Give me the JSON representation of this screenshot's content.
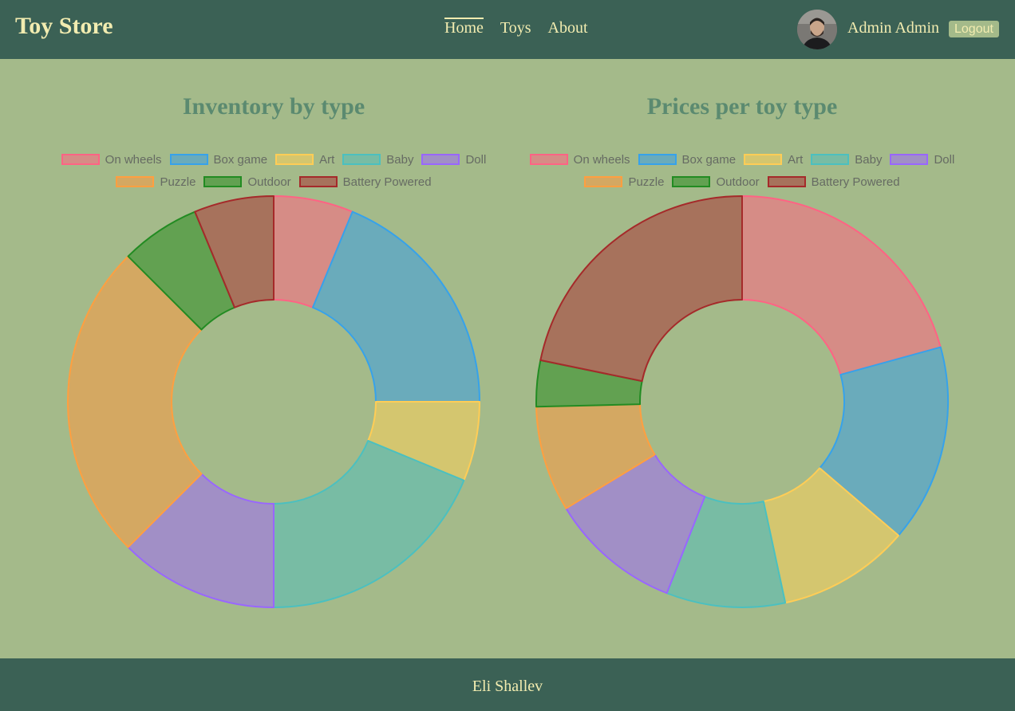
{
  "header": {
    "brand": "Toy Store",
    "nav": [
      {
        "label": "Home",
        "active": true
      },
      {
        "label": "Toys",
        "active": false
      },
      {
        "label": "About",
        "active": false
      }
    ],
    "user_name": "Admin Admin",
    "logout_label": "Logout"
  },
  "footer": {
    "text": "Eli Shallev"
  },
  "colors": {
    "header_bg": "#3b6155",
    "page_bg": "#a4ba8a",
    "accent_text": "#f2ecb0",
    "title_text": "#5b8a70"
  },
  "series_colors": [
    {
      "fill": "#d68c86",
      "stroke": "#ff6384"
    },
    {
      "fill": "#6aabbb",
      "stroke": "#36a2eb"
    },
    {
      "fill": "#d4c66f",
      "stroke": "#ffcd56"
    },
    {
      "fill": "#78bca4",
      "stroke": "#4bc0c0"
    },
    {
      "fill": "#a18fc6",
      "stroke": "#9966ff"
    },
    {
      "fill": "#d4a862",
      "stroke": "#ff9f40"
    },
    {
      "fill": "#62a151",
      "stroke": "#228b22"
    },
    {
      "fill": "#a7725c",
      "stroke": "#a52a2a"
    }
  ],
  "chart_data": [
    {
      "type": "pie",
      "title": "Inventory by type",
      "categories": [
        "On wheels",
        "Box game",
        "Art",
        "Baby",
        "Doll",
        "Puzzle",
        "Outdoor",
        "Battery Powered"
      ],
      "values": [
        1,
        3,
        1,
        3,
        2,
        4,
        1,
        1
      ],
      "legend_position": "top"
    },
    {
      "type": "pie",
      "title": "Prices per toy type",
      "categories": [
        "On wheels",
        "Box game",
        "Art",
        "Baby",
        "Doll",
        "Puzzle",
        "Outdoor",
        "Battery Powered"
      ],
      "values": [
        20,
        15,
        10,
        9,
        10,
        8,
        3.5,
        21
      ],
      "legend_position": "top"
    }
  ]
}
